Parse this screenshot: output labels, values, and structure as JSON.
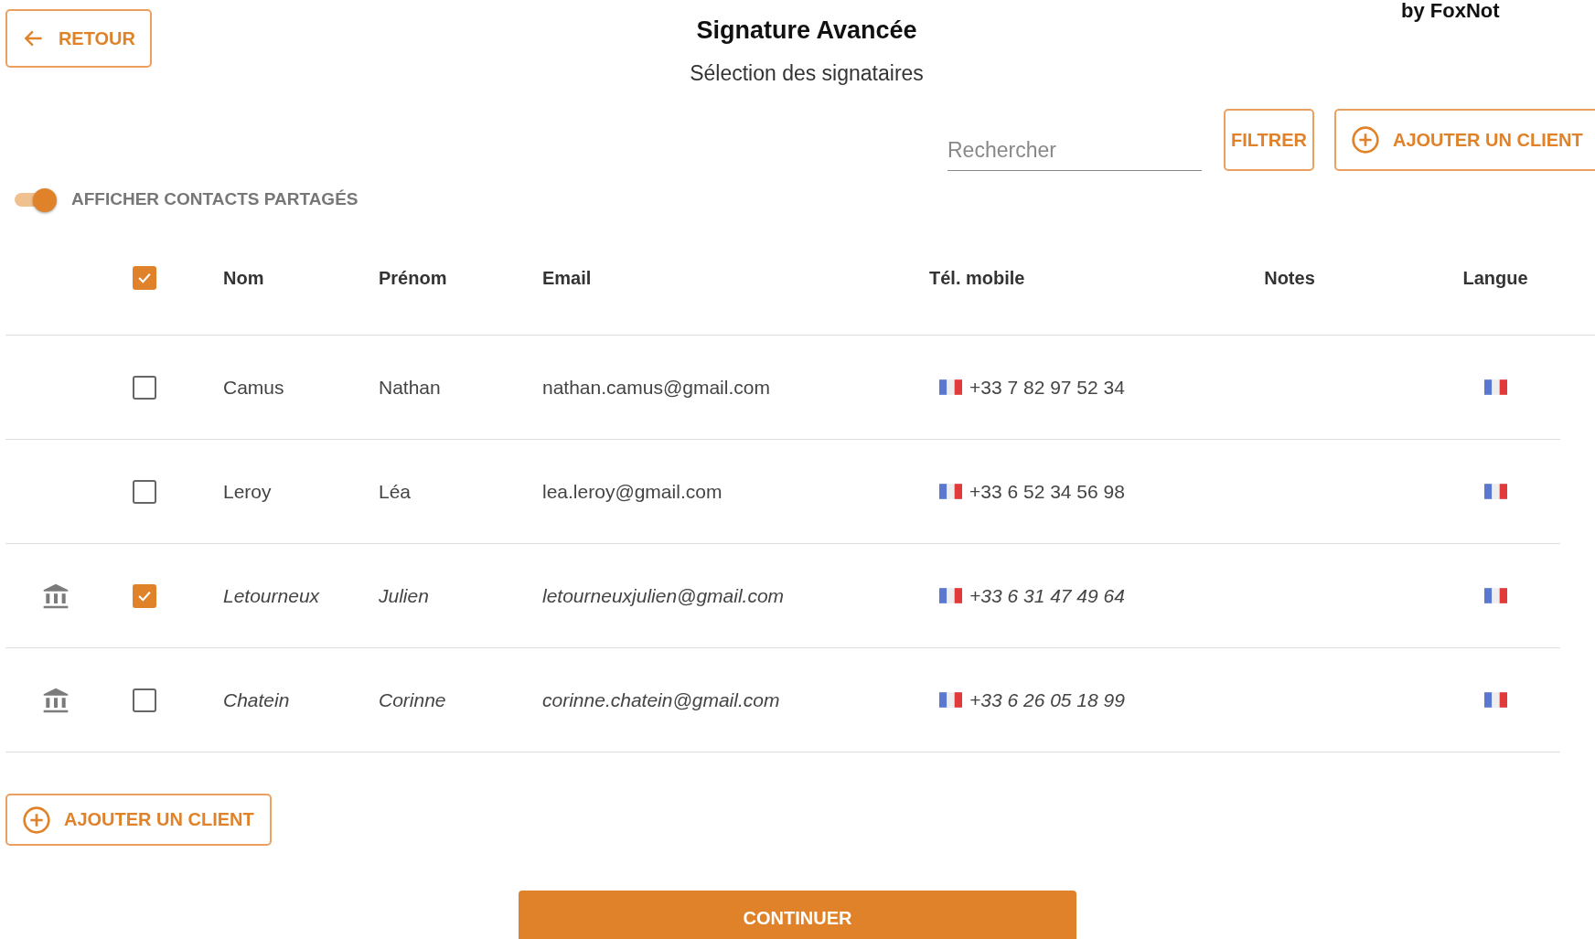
{
  "brand": "by FoxNot",
  "back_button": "RETOUR",
  "title": "Signature Avancée",
  "subtitle": "Sélection des signataires",
  "search": {
    "placeholder": "Rechercher"
  },
  "filter_button": "FILTRER",
  "add_client_top": "AJOUTER UN CLIENT",
  "shared_toggle": {
    "label": "AFFICHER CONTACTS PARTAGÉS",
    "on": true
  },
  "table": {
    "select_all": {
      "checked": true
    },
    "columns": [
      "Nom",
      "Prénom",
      "Email",
      "Tél. mobile",
      "Notes",
      "Langue"
    ],
    "rows": [
      {
        "shared": false,
        "checked": false,
        "nom": "Camus",
        "prenom": "Nathan",
        "email": "nathan.camus@gmail.com",
        "tel": "+33 7 82 97 52 34"
      },
      {
        "shared": false,
        "checked": false,
        "nom": "Leroy",
        "prenom": "Léa",
        "email": "lea.leroy@gmail.com",
        "tel": "+33 6 52 34 56 98"
      },
      {
        "shared": true,
        "checked": true,
        "nom": "Letourneux",
        "prenom": "Julien",
        "email": "letourneuxjulien@gmail.com",
        "tel": "+33 6 31 47 49 64"
      },
      {
        "shared": true,
        "checked": false,
        "nom": "Chatein",
        "prenom": "Corinne",
        "email": "corinne.chatein@gmail.com",
        "tel": "+33 6 26 05 18 99"
      }
    ]
  },
  "add_client_bottom": "AJOUTER UN CLIENT",
  "continue_button": "CONTINUER"
}
